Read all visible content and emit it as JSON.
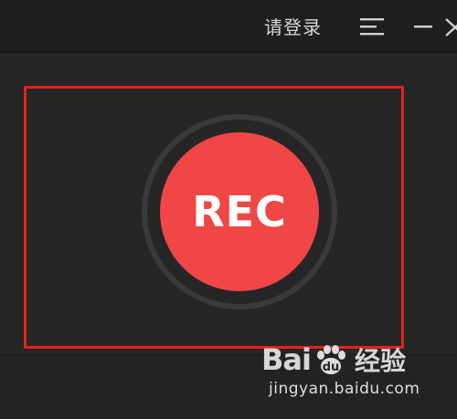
{
  "titlebar": {
    "login_label": "请登录"
  },
  "icons": {
    "menu": "menu-icon",
    "minimize": "minimize-icon",
    "close": "close-icon"
  },
  "recorder": {
    "rec_label": "REC"
  },
  "colors": {
    "rec_button": "#f04646",
    "highlight_border": "#e8201c",
    "background": "#262626"
  },
  "watermark": {
    "brand_prefix": "Bai",
    "brand_suffix": "经验",
    "url": "jingyan.baidu.com"
  }
}
